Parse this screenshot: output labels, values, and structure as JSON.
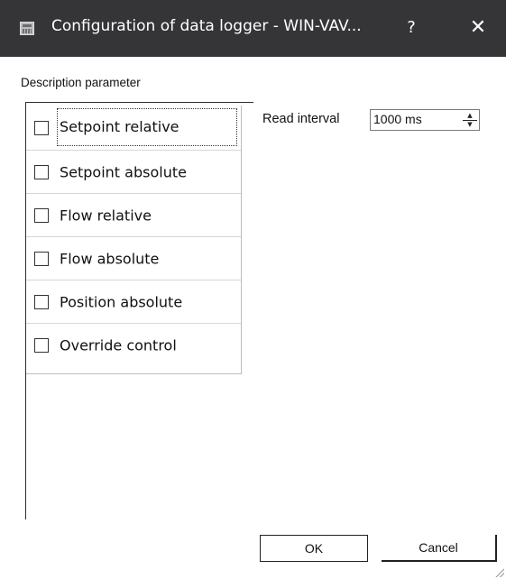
{
  "window": {
    "title": "Configuration of data logger - WIN-VAV...",
    "help_label": "?",
    "close_label": "✕"
  },
  "description_group": {
    "label": "Description parameter",
    "items": [
      {
        "label": "Setpoint relative",
        "checked": false,
        "focused": true
      },
      {
        "label": "Setpoint absolute",
        "checked": false
      },
      {
        "label": "Flow relative",
        "checked": false
      },
      {
        "label": "Flow absolute",
        "checked": false
      },
      {
        "label": "Position absolute",
        "checked": false
      },
      {
        "label": "Override control",
        "checked": false
      }
    ]
  },
  "read_interval": {
    "label": "Read interval",
    "value": "1000 ms",
    "up_icon": "spin-up-icon",
    "down_icon": "spin-down-icon"
  },
  "buttons": {
    "ok_label": "OK",
    "cancel_label": "Cancel"
  }
}
